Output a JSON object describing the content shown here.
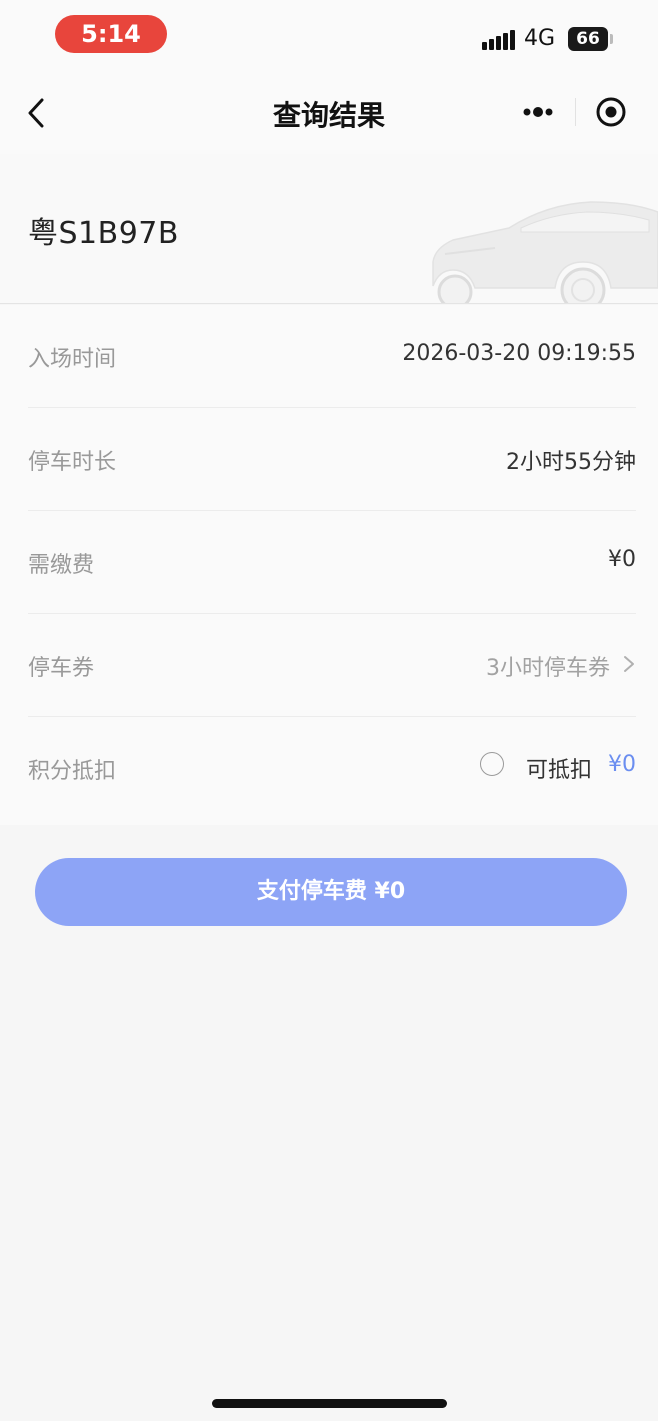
{
  "status_bar": {
    "time": "5:14",
    "network": "4G",
    "battery": "66"
  },
  "nav": {
    "title": "查询结果"
  },
  "plate": "粤S1B97B",
  "rows": [
    {
      "label": "入场时间",
      "value": "2026-03-20 09:19:55"
    },
    {
      "label": "停车时长",
      "value": "2小时55分钟"
    },
    {
      "label": "需缴费",
      "value": "¥0"
    },
    {
      "label": "停车券",
      "value": "3小时停车券"
    },
    {
      "label": "积分抵扣",
      "option_label": "可抵扣",
      "option_value": "¥0"
    }
  ],
  "pay_button": "支付停车费 ¥0",
  "colors": {
    "time_pill": "#e8453c",
    "accent": "#8da4f6",
    "deduct_value": "#6b8ef0"
  },
  "icons": {
    "back": "chevron-left-icon",
    "more": "more-dots-icon",
    "close": "target-close-icon",
    "coupon_arrow": "chevron-right-icon",
    "car": "car-icon"
  }
}
